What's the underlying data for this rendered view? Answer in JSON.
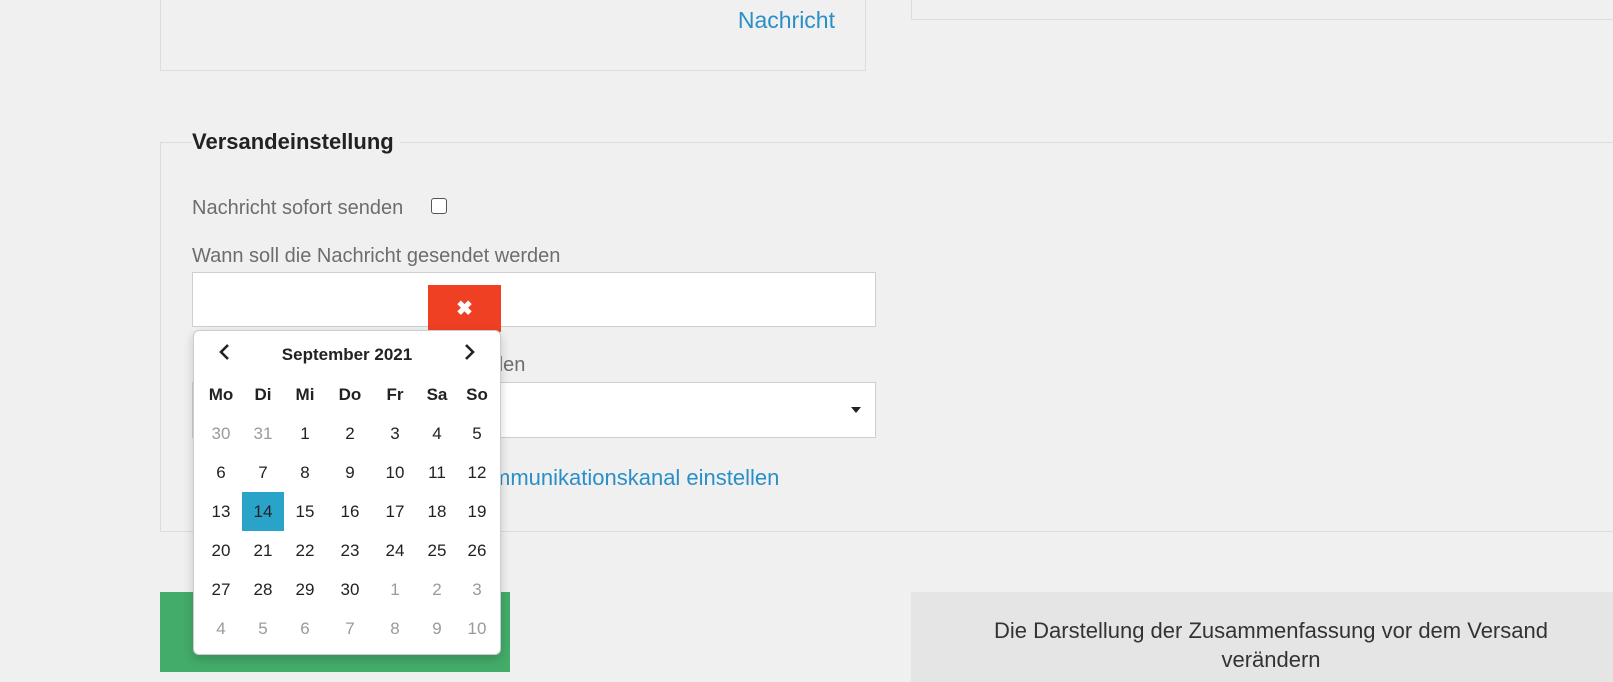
{
  "top_card": {
    "link_label": "Nachricht"
  },
  "settings": {
    "legend": "Versandeinstellung",
    "send_now_label": "Nachricht sofort senden",
    "when_label": "Wann soll die Nachricht gesendet werden",
    "clear_icon": "close-icon",
    "channel_label_visible": "den",
    "channel_link_visible": "mmunikationskanal einstellen"
  },
  "summary": {
    "text": "Die Darstellung der Zusammenfassung vor dem Versand verändern"
  },
  "datepicker": {
    "month_title": "September 2021",
    "prev_icon": "chevron-left-icon",
    "next_icon": "chevron-right-icon",
    "weekdays": [
      "Mo",
      "Di",
      "Mi",
      "Do",
      "Fr",
      "Sa",
      "So"
    ],
    "weeks": [
      [
        "30",
        "31",
        "1",
        "2",
        "3",
        "4",
        "5"
      ],
      [
        "6",
        "7",
        "8",
        "9",
        "10",
        "11",
        "12"
      ],
      [
        "13",
        "14",
        "15",
        "16",
        "17",
        "18",
        "19"
      ],
      [
        "20",
        "21",
        "22",
        "23",
        "24",
        "25",
        "26"
      ],
      [
        "27",
        "28",
        "29",
        "30",
        "1",
        "2",
        "3"
      ],
      [
        "4",
        "5",
        "6",
        "7",
        "8",
        "9",
        "10"
      ]
    ],
    "muted": [
      [
        0,
        0
      ],
      [
        0,
        1
      ],
      [
        4,
        4
      ],
      [
        4,
        5
      ],
      [
        4,
        6
      ],
      [
        5,
        0
      ],
      [
        5,
        1
      ],
      [
        5,
        2
      ],
      [
        5,
        3
      ],
      [
        5,
        4
      ],
      [
        5,
        5
      ],
      [
        5,
        6
      ]
    ],
    "selected": [
      2,
      1
    ],
    "colors": {
      "selected": "#2aa3c9",
      "clear_button": "#ef4023",
      "submit_button": "#43ac6a",
      "link": "#2a8fc7"
    }
  }
}
